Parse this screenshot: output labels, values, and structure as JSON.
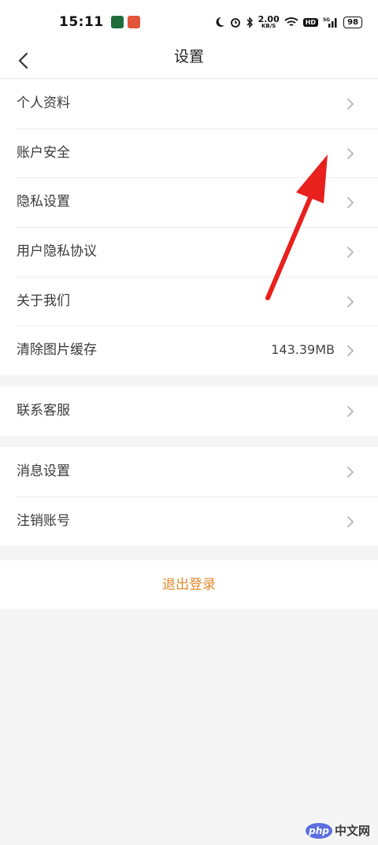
{
  "status_bar": {
    "time": "15:11",
    "net_speed": "2.00",
    "net_unit": "KB/S",
    "hd": "HD",
    "signal": "5G",
    "battery": "98"
  },
  "header": {
    "title": "设置"
  },
  "groups": [
    {
      "items": [
        {
          "label": "个人资料"
        },
        {
          "label": "账户安全"
        },
        {
          "label": "隐私设置"
        },
        {
          "label": "用户隐私协议"
        },
        {
          "label": "关于我们"
        },
        {
          "label": "清除图片缓存",
          "value": "143.39MB"
        }
      ]
    },
    {
      "items": [
        {
          "label": "联系客服"
        }
      ]
    },
    {
      "items": [
        {
          "label": "消息设置"
        },
        {
          "label": "注销账号"
        }
      ]
    }
  ],
  "logout_label": "退出登录",
  "colors": {
    "accent": "#e08a2c",
    "annotation_arrow": "#e8201e",
    "background": "#f5f5f5"
  },
  "watermark": {
    "logo": "php",
    "text": "中文网"
  }
}
